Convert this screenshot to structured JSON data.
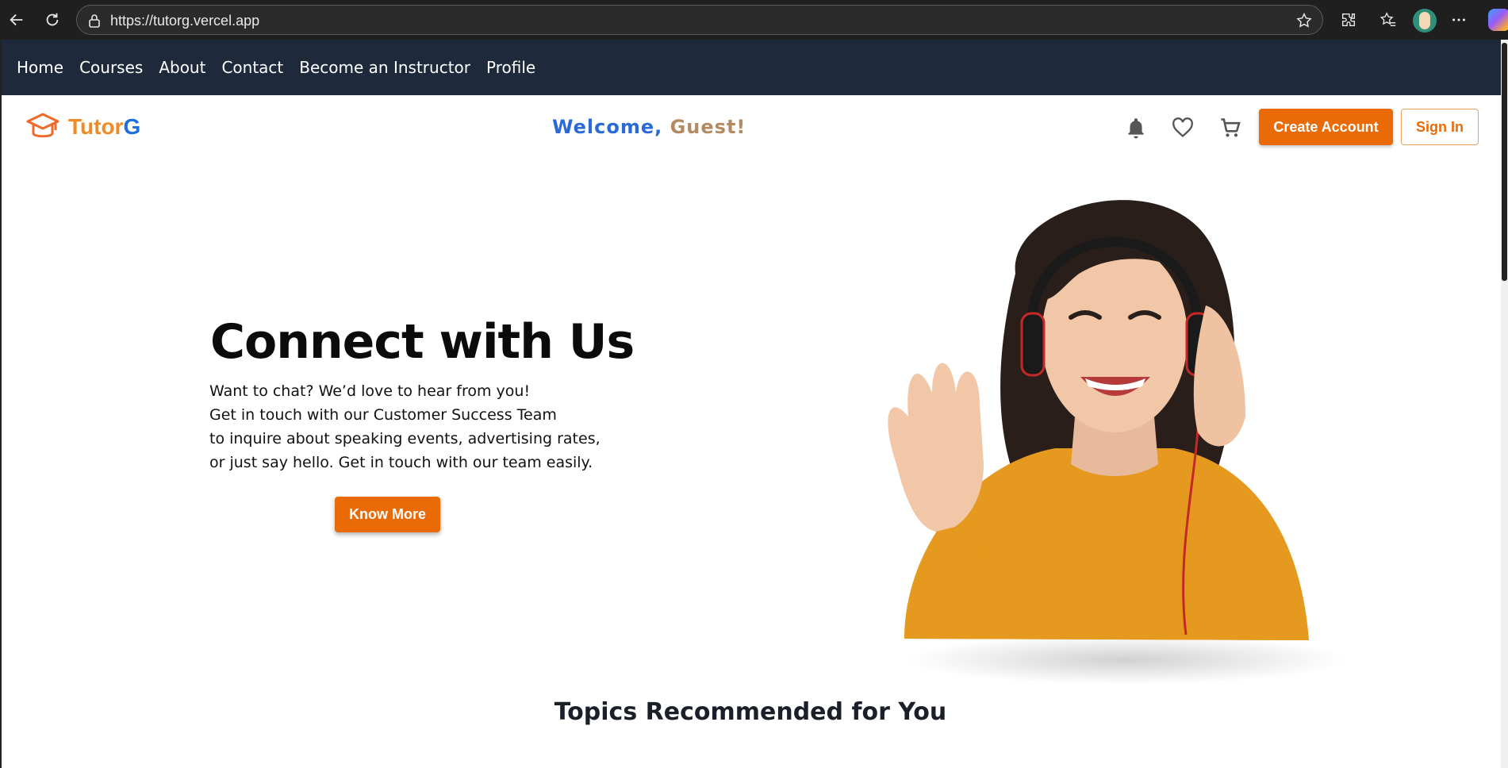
{
  "browser": {
    "url": "https://tutorg.vercel.app"
  },
  "nav": {
    "items": [
      "Home",
      "Courses",
      "About",
      "Contact",
      "Become an Instructor",
      "Profile"
    ]
  },
  "header": {
    "brand_part1": "Tutor",
    "brand_part2": "G",
    "welcome_part1": "Welcome,",
    "welcome_part2": "Guest!",
    "create_account_label": "Create Account",
    "sign_in_label": "Sign In",
    "icons": [
      "bell-icon",
      "heart-icon",
      "cart-icon"
    ]
  },
  "hero": {
    "title": "Connect with Us",
    "lines": [
      "Want to chat? We’d love to hear from you!",
      "Get in touch with our Customer Success Team",
      "to inquire about speaking events, advertising rates,",
      "or just say hello. Get in touch with our team easily."
    ],
    "cta_label": "Know More"
  },
  "section": {
    "topics_title": "Topics Recommended for You"
  },
  "colors": {
    "accent": "#ea6a06",
    "nav_bg": "#1e293b",
    "brand_orange": "#f08a24",
    "brand_blue": "#1d6ee0"
  }
}
